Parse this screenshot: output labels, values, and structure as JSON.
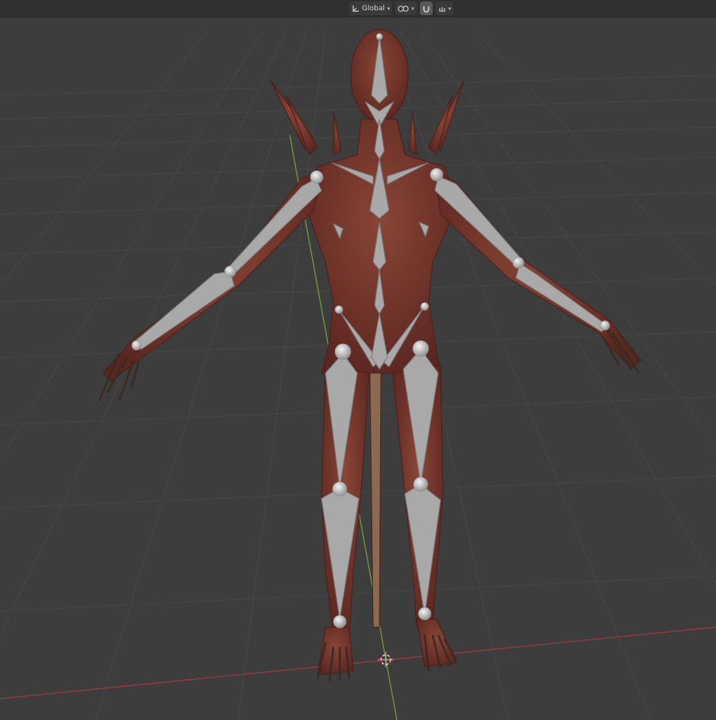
{
  "header": {
    "transform_orientation": {
      "label": "Global",
      "icon": "transform-orientation-icon"
    },
    "pivot": {
      "icon": "pivot-point-icon"
    },
    "snap": {
      "icon": "snap-magnet-icon"
    },
    "snap_target": {
      "icon": "snap-increment-icon"
    }
  },
  "viewport": {
    "object": "rigged-creature-with-armature",
    "grid": true,
    "axes": {
      "x_color": "#9a3a45",
      "y_color": "#6f9a3a"
    }
  },
  "colors": {
    "background": "#3d3d3d",
    "grid": "#4a4a4a",
    "bone": "#a9a9a9",
    "bone_edge": "#7a7a7a",
    "joint": "#d6d6d6",
    "skin": "#7a3a30"
  }
}
